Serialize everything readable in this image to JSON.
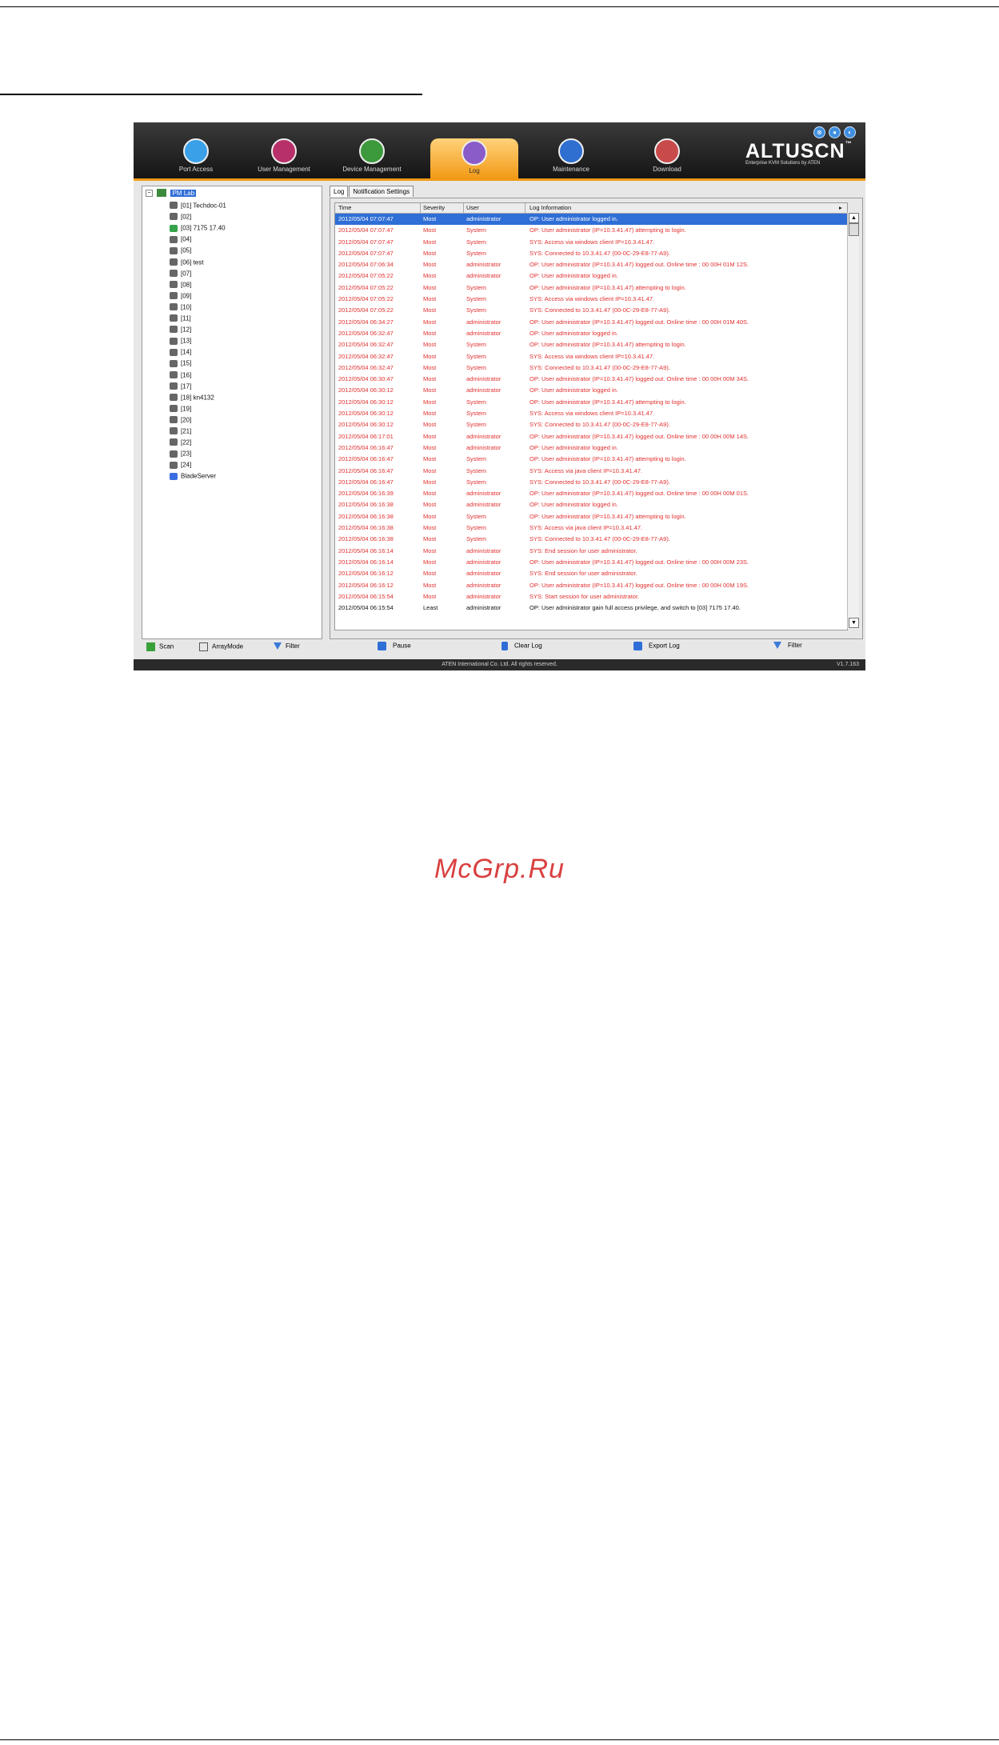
{
  "app": {
    "nav": [
      {
        "label": "Port Access",
        "color": "#3aa0e8"
      },
      {
        "label": "User Management",
        "color": "#b8306a"
      },
      {
        "label": "Device Management",
        "color": "#3c9a3c"
      },
      {
        "label": "Log",
        "color": "#8a5cc8"
      },
      {
        "label": "Maintenance",
        "color": "#2f6fd0"
      },
      {
        "label": "Download",
        "color": "#c84a4a"
      }
    ],
    "brand": "ALTUSCN",
    "brand_tm": "™",
    "brand_sub": "Enterprise KVM Solutions by ATEN",
    "window_buttons": [
      "⊗",
      "●",
      "◐"
    ]
  },
  "tree": {
    "root": "PM Lab",
    "expander": "−",
    "nodes": [
      {
        "label": "[01] Techdoc-01",
        "status": "normal"
      },
      {
        "label": "[02]",
        "status": "normal"
      },
      {
        "label": "[03] 7175 17.40",
        "status": "online"
      },
      {
        "label": "[04]",
        "status": "normal"
      },
      {
        "label": "[05]",
        "status": "normal"
      },
      {
        "label": "[06] test",
        "status": "normal"
      },
      {
        "label": "[07]",
        "status": "normal"
      },
      {
        "label": "[08]",
        "status": "normal"
      },
      {
        "label": "[09]",
        "status": "normal"
      },
      {
        "label": "[10]",
        "status": "normal"
      },
      {
        "label": "[11]",
        "status": "normal"
      },
      {
        "label": "[12]",
        "status": "normal"
      },
      {
        "label": "[13]",
        "status": "normal"
      },
      {
        "label": "[14]",
        "status": "normal"
      },
      {
        "label": "[15]",
        "status": "normal"
      },
      {
        "label": "[16]",
        "status": "normal"
      },
      {
        "label": "[17]",
        "status": "normal"
      },
      {
        "label": "[18] kn4132",
        "status": "normal"
      },
      {
        "label": "[19]",
        "status": "normal"
      },
      {
        "label": "[20]",
        "status": "normal"
      },
      {
        "label": "[21]",
        "status": "normal"
      },
      {
        "label": "[22]",
        "status": "normal"
      },
      {
        "label": "[23]",
        "status": "normal"
      },
      {
        "label": "[24]",
        "status": "normal"
      },
      {
        "label": "BladeServer",
        "status": "blade"
      }
    ]
  },
  "left_toolbar": {
    "scan": "Scan",
    "array_mode": "ArrayMode",
    "filter": "Filter"
  },
  "tabs": {
    "log": "Log",
    "notification": "Notification Settings"
  },
  "grid": {
    "headers": {
      "time": "Time",
      "severity": "Severity",
      "user": "User",
      "info": "Log Information"
    },
    "header_arrow": "▸",
    "rows": [
      [
        "2012/05/04 07:07:47",
        "Most",
        "administrator",
        "OP: User administrator logged in."
      ],
      [
        "2012/05/04 07:07:47",
        "Most",
        "System",
        "OP: User administrator (IP=10.3.41.47) attempting to login."
      ],
      [
        "2012/05/04 07:07:47",
        "Most",
        "System",
        "SYS: Access via windows client IP=10.3.41.47."
      ],
      [
        "2012/05/04 07:07:47",
        "Most",
        "System",
        "SYS: Connected to 10.3.41.47 (00-0C-29-E8-77-A9)."
      ],
      [
        "2012/05/04 07:06:34",
        "Most",
        "administrator",
        "OP: User administrator (IP=10.3.41.47) logged out. Online time : 00 00H 01M 12S."
      ],
      [
        "2012/05/04 07:05:22",
        "Most",
        "administrator",
        "OP: User administrator logged in."
      ],
      [
        "2012/05/04 07:05:22",
        "Most",
        "System",
        "OP: User administrator (IP=10.3.41.47) attempting to login."
      ],
      [
        "2012/05/04 07:05:22",
        "Most",
        "System",
        "SYS: Access via windows client IP=10.3.41.47."
      ],
      [
        "2012/05/04 07:05:22",
        "Most",
        "System",
        "SYS: Connected to 10.3.41.47 (00-0C-29-E8-77-A9)."
      ],
      [
        "2012/05/04 06:34:27",
        "Most",
        "administrator",
        "OP: User administrator (IP=10.3.41.47) logged out. Online time : 00 00H 01M 40S."
      ],
      [
        "2012/05/04 06:32:47",
        "Most",
        "administrator",
        "OP: User administrator logged in."
      ],
      [
        "2012/05/04 06:32:47",
        "Most",
        "System",
        "OP: User administrator (IP=10.3.41.47) attempting to login."
      ],
      [
        "2012/05/04 06:32:47",
        "Most",
        "System",
        "SYS: Access via windows client IP=10.3.41.47."
      ],
      [
        "2012/05/04 06:32:47",
        "Most",
        "System",
        "SYS: Connected to 10.3.41.47 (00-0C-29-E8-77-A9)."
      ],
      [
        "2012/05/04 06:30:47",
        "Most",
        "administrator",
        "OP: User administrator (IP=10.3.41.47) logged out. Online time : 00 00H 00M 34S."
      ],
      [
        "2012/05/04 06:30:12",
        "Most",
        "administrator",
        "OP: User administrator logged in."
      ],
      [
        "2012/05/04 06:30:12",
        "Most",
        "System",
        "OP: User administrator (IP=10.3.41.47) attempting to login."
      ],
      [
        "2012/05/04 06:30:12",
        "Most",
        "System",
        "SYS: Access via windows client IP=10.3.41.47."
      ],
      [
        "2012/05/04 06:30:12",
        "Most",
        "System",
        "SYS: Connected to 10.3.41.47 (00-0C-29-E8-77-A9)."
      ],
      [
        "2012/05/04 06:17:01",
        "Most",
        "administrator",
        "OP: User administrator (IP=10.3.41.47) logged out. Online time : 00 00H 00M 14S."
      ],
      [
        "2012/05/04 06:16:47",
        "Most",
        "administrator",
        "OP: User administrator logged in."
      ],
      [
        "2012/05/04 06:16:47",
        "Most",
        "System",
        "OP: User administrator (IP=10.3.41.47) attempting to login."
      ],
      [
        "2012/05/04 06:16:47",
        "Most",
        "System",
        "SYS: Access via java client IP=10.3.41.47."
      ],
      [
        "2012/05/04 06:16:47",
        "Most",
        "System",
        "SYS: Connected to 10.3.41.47 (00-0C-29-E8-77-A9)."
      ],
      [
        "2012/05/04 06:16:39",
        "Most",
        "administrator",
        "OP: User administrator (IP=10.3.41.47) logged out. Online time : 00 00H 00M 01S."
      ],
      [
        "2012/05/04 06:16:38",
        "Most",
        "administrator",
        "OP: User administrator logged in."
      ],
      [
        "2012/05/04 06:16:38",
        "Most",
        "System",
        "OP: User administrator (IP=10.3.41.47) attempting to login."
      ],
      [
        "2012/05/04 06:16:38",
        "Most",
        "System",
        "SYS: Access via java client IP=10.3.41.47."
      ],
      [
        "2012/05/04 06:16:38",
        "Most",
        "System",
        "SYS: Connected to 10.3.41.47 (00-0C-29-E8-77-A9)."
      ],
      [
        "2012/05/04 06:16:14",
        "Most",
        "administrator",
        "SYS: End session for user administrator."
      ],
      [
        "2012/05/04 06:16:14",
        "Most",
        "administrator",
        "OP: User administrator (IP=10.3.41.47) logged out. Online time : 00 00H 00M 23S."
      ],
      [
        "2012/05/04 06:16:12",
        "Most",
        "administrator",
        "SYS: End session for user administrator."
      ],
      [
        "2012/05/04 06:16:12",
        "Most",
        "administrator",
        "OP: User administrator (IP=10.3.41.47) logged out. Online time : 00 00H 00M 19S."
      ],
      [
        "2012/05/04 06:15:54",
        "Most",
        "administrator",
        "SYS: Start session for user administrator."
      ],
      [
        "2012/05/04 06:15:54",
        "Least",
        "administrator",
        "OP: User administrator gain full access privilege, and switch to [03] 7175 17.40."
      ]
    ],
    "scroll_up": "▲",
    "scroll_down": "▼"
  },
  "panel_toolbar": {
    "pause": "Pause",
    "clear_log": "Clear Log",
    "export_log": "Export Log",
    "filter": "Filter"
  },
  "status": {
    "copyright": "ATEN International Co. Ltd. All rights reserved.",
    "version": "V1.7.163"
  },
  "watermark": "McGrp.Ru"
}
